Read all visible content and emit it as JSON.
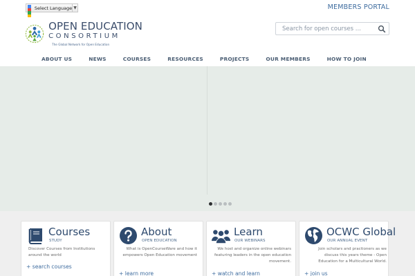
{
  "language": {
    "label": "Select Language",
    "arrow": "▼"
  },
  "members_portal": "MEMBERS PORTAL",
  "logo": {
    "line1": "OPEN EDUCATION",
    "line2": "CONSORTIUM",
    "tagline": "The Global Network for Open Education"
  },
  "search": {
    "placeholder": "Search for open courses ..."
  },
  "nav": [
    "ABOUT US",
    "NEWS",
    "COURSES",
    "RESOURCES",
    "PROJECTS",
    "OUR MEMBERS",
    "HOW TO JOIN"
  ],
  "slider": {
    "slide_count": 5,
    "active_index": 0
  },
  "cards": [
    {
      "title": "Courses",
      "subtitle": "STUDY",
      "description": "Discover Courses from Institutions around the world",
      "link": "+ search courses",
      "icon": "book-icon"
    },
    {
      "title": "About",
      "subtitle": "OPEN EDUCATION",
      "description": "What is OpenCourseWare and how it empowers Open Education movement",
      "link": "+ learn more",
      "icon": "question-icon"
    },
    {
      "title": "Learn",
      "subtitle": "OUR WEBINARS",
      "description": "We host and organize online webinars featuring leaders in the open education movement.",
      "link": "+ watch and learn",
      "icon": "people-icon"
    },
    {
      "title": "OCWC Global",
      "subtitle": "OUR ANNUAL EVENT",
      "description": "Join scholars and practioners as we discuss this years theme - Open Education for a Multicultural World.",
      "link": "+ join us",
      "icon": "globe-icon"
    }
  ],
  "colors": {
    "brand": "#3b4d6b",
    "link": "#3d6b9e",
    "slider_bg": "#e6ece8",
    "cards_bg": "#efefef"
  }
}
